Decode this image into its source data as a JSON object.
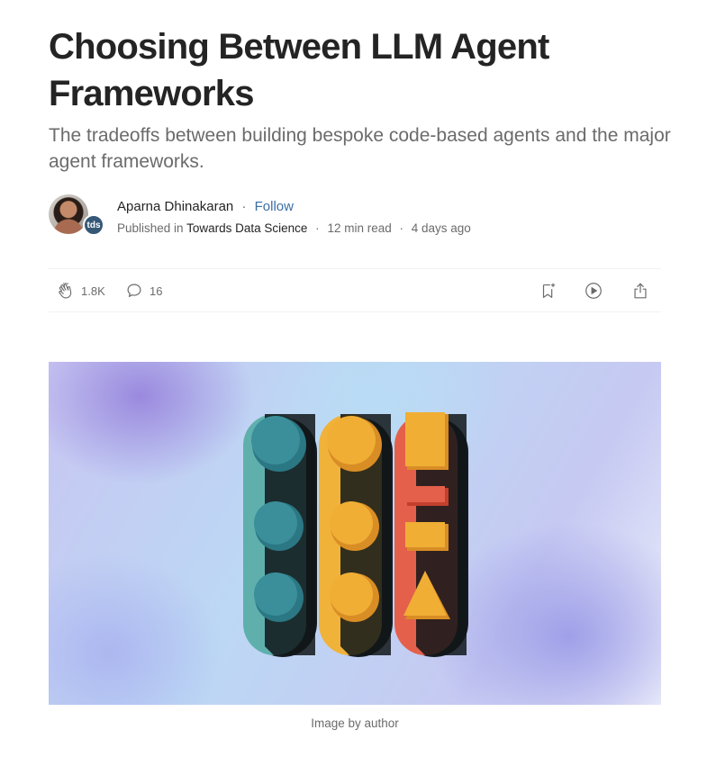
{
  "article": {
    "title": "Choosing Between LLM Agent Frameworks",
    "subtitle": "The tradeoffs between building bespoke code-based agents and the major agent frameworks."
  },
  "byline": {
    "author_name": "Aparna Dhinakaran",
    "follow_label": "Follow",
    "published_in_label": "Published in",
    "publication": "Towards Data Science",
    "publication_badge": "tds",
    "read_time": "12 min read",
    "posted": "4 days ago"
  },
  "actions": {
    "claps": "1.8K",
    "responses": "16"
  },
  "hero": {
    "caption": "Image by author"
  },
  "colors": {
    "text": "#242424",
    "muted": "#6b6b6b",
    "follow": "#3b6ea5",
    "teal": "#3a8f9a",
    "orange": "#f0ae35",
    "red": "#e4604a"
  }
}
